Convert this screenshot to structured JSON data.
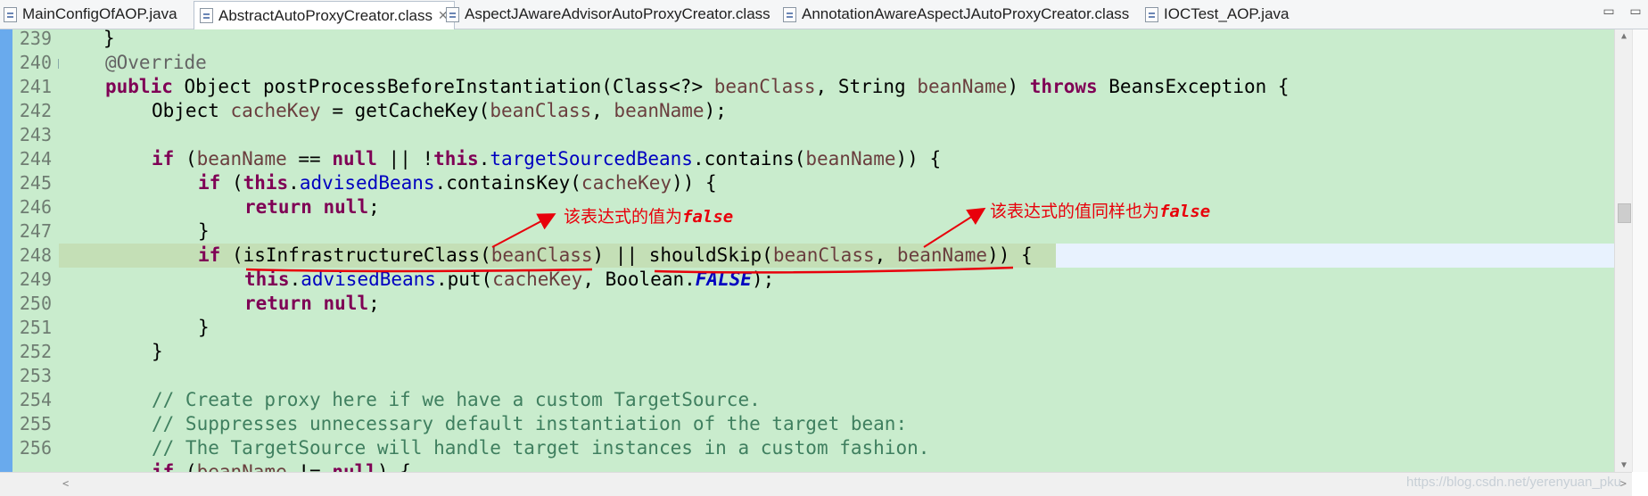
{
  "tabs": [
    {
      "label": "MainConfigOfAOP.java",
      "active": false
    },
    {
      "label": "AbstractAutoProxyCreator.class",
      "active": true,
      "close": "✕"
    },
    {
      "label": "AspectJAwareAdvisorAutoProxyCreator.class",
      "active": false
    },
    {
      "label": "AnnotationAwareAspectJAutoProxyCreator.class",
      "active": false
    },
    {
      "label": "IOCTest_AOP.java",
      "active": false
    }
  ],
  "window_buttons": {
    "minimize": "▭",
    "maximize": "▭"
  },
  "line_numbers": [
    "239",
    "240",
    "241",
    "242",
    "243",
    "244",
    "245",
    "246",
    "247",
    "248",
    "249",
    "250",
    "251",
    "252",
    "253",
    "254",
    "255",
    "256"
  ],
  "annotations": {
    "note1": "该表达式的值为",
    "note1_value": "false",
    "note2": "该表达式的值同样也为",
    "note2_value": "false"
  },
  "watermark": "https://blog.csdn.net/yerenyuan_pku",
  "colors": {
    "editor_bg": "#c9eccd",
    "keyword": "#7f0055",
    "field": "#0000c0",
    "comment": "#3f7f5f",
    "annotation_red": "#e8000b",
    "current_line": "#c4dfb6"
  }
}
